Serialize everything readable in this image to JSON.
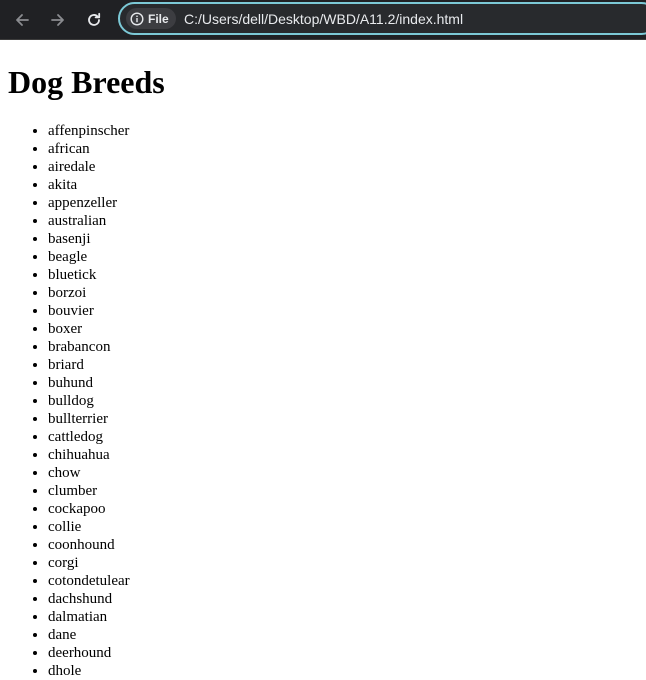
{
  "browser": {
    "chip_label": "File",
    "url": "C:/Users/dell/Desktop/WBD/A11.2/index.html"
  },
  "page": {
    "title": "Dog Breeds",
    "breeds": [
      "affenpinscher",
      "african",
      "airedale",
      "akita",
      "appenzeller",
      "australian",
      "basenji",
      "beagle",
      "bluetick",
      "borzoi",
      "bouvier",
      "boxer",
      "brabancon",
      "briard",
      "buhund",
      "bulldog",
      "bullterrier",
      "cattledog",
      "chihuahua",
      "chow",
      "clumber",
      "cockapoo",
      "collie",
      "coonhound",
      "corgi",
      "cotondetulear",
      "dachshund",
      "dalmatian",
      "dane",
      "deerhound",
      "dhole"
    ]
  },
  "icons": {
    "back": "arrow-left-icon",
    "forward": "arrow-right-icon",
    "reload": "reload-icon",
    "site_info": "info-circle-icon"
  },
  "colors": {
    "toolbar": "#202124",
    "omnibox_border": "#7cc9d6",
    "omnibox_bg": "#282a2d",
    "text_light": "#e8eaed",
    "icon_dim": "#8a8c90"
  }
}
